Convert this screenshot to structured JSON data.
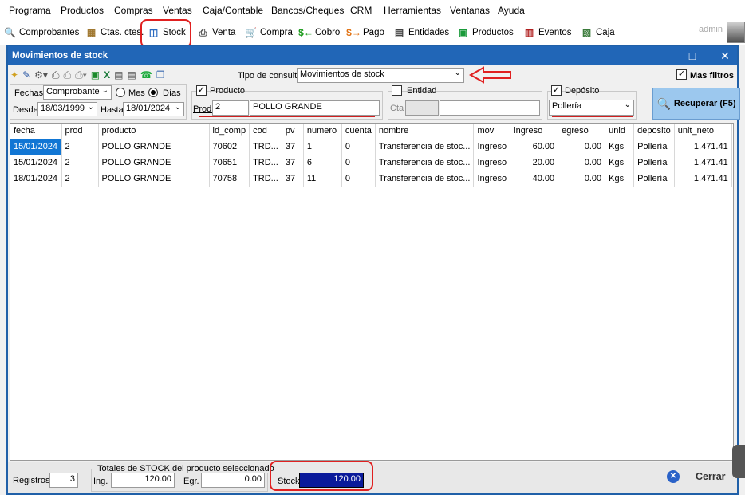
{
  "menu": [
    "Programa",
    "Productos",
    "Compras",
    "Ventas",
    "Caja/Contable",
    "Bancos/Cheques",
    "CRM",
    "Herramientas",
    "Ventanas",
    "Ayuda"
  ],
  "toolbar": [
    {
      "label": "Comprobantes",
      "icon": "document-search-icon"
    },
    {
      "label": "Ctas. ctes.",
      "icon": "accounts-icon"
    },
    {
      "label": "Stock",
      "icon": "stock-icon"
    },
    {
      "label": "Venta",
      "icon": "printer-icon"
    },
    {
      "label": "Compra",
      "icon": "cart-icon"
    },
    {
      "label": "Cobro",
      "icon": "cash-in-icon"
    },
    {
      "label": "Pago",
      "icon": "cash-out-icon"
    },
    {
      "label": "Entidades",
      "icon": "contacts-icon"
    },
    {
      "label": "Productos",
      "icon": "box-icon"
    },
    {
      "label": "Eventos",
      "icon": "calendar-icon"
    },
    {
      "label": "Caja",
      "icon": "cashbox-icon"
    }
  ],
  "user": "admin",
  "window": {
    "title": "Movimientos de stock"
  },
  "query": {
    "label": "Tipo de consulta",
    "value": "Movimientos de stock",
    "more_filters": "Mas filtros"
  },
  "filters": {
    "fechas_label": "Fechas",
    "fechas_value": "Comprobante",
    "mes": "Mes",
    "dias": "Días",
    "desde_label": "Desde",
    "desde_value": "18/03/1999",
    "hasta_label": "Hasta",
    "hasta_value": "18/01/2024",
    "producto_label": "Producto",
    "prod_label": "Prod.",
    "prod_code": "2",
    "prod_name": "POLLO GRANDE",
    "entidad_label": "Entidad",
    "cta_label": "Cta",
    "deposito_label": "Depósito",
    "deposito_value": "Pollería",
    "recuperar": "Recuperar (F5)"
  },
  "table": {
    "columns": [
      "fecha",
      "prod",
      "producto",
      "id_comp",
      "cod",
      "pv",
      "numero",
      "cuenta",
      "nombre",
      "mov",
      "ingreso",
      "egreso",
      "unid",
      "deposito",
      "unit_neto"
    ],
    "rows": [
      [
        "15/01/2024",
        "2",
        "POLLO GRANDE",
        "70602",
        "TRD...",
        "37",
        "1",
        "0",
        "Transferencia de stoc...",
        "Ingreso",
        "60.00",
        "0.00",
        "Kgs",
        "Pollería",
        "1,471.41"
      ],
      [
        "15/01/2024",
        "2",
        "POLLO GRANDE",
        "70651",
        "TRD...",
        "37",
        "6",
        "0",
        "Transferencia de stoc...",
        "Ingreso",
        "20.00",
        "0.00",
        "Kgs",
        "Pollería",
        "1,471.41"
      ],
      [
        "18/01/2024",
        "2",
        "POLLO GRANDE",
        "70758",
        "TRD...",
        "37",
        "11",
        "0",
        "Transferencia de stoc...",
        "Ingreso",
        "40.00",
        "0.00",
        "Kgs",
        "Pollería",
        "1,471.41"
      ]
    ]
  },
  "footer": {
    "registros_label": "Registros",
    "registros_value": "3",
    "totales_title": "Totales de STOCK del producto seleccionado",
    "ing_label": "Ing.",
    "ing_value": "120.00",
    "egr_label": "Egr.",
    "egr_value": "0.00",
    "stock_label": "Stock",
    "stock_value": "120.00",
    "cerrar": "Cerrar"
  },
  "colors": {
    "titlebar": "#2166b7",
    "selection": "#1176d4",
    "annotation": "#e02020",
    "stock_box": "#0a1a9a"
  }
}
